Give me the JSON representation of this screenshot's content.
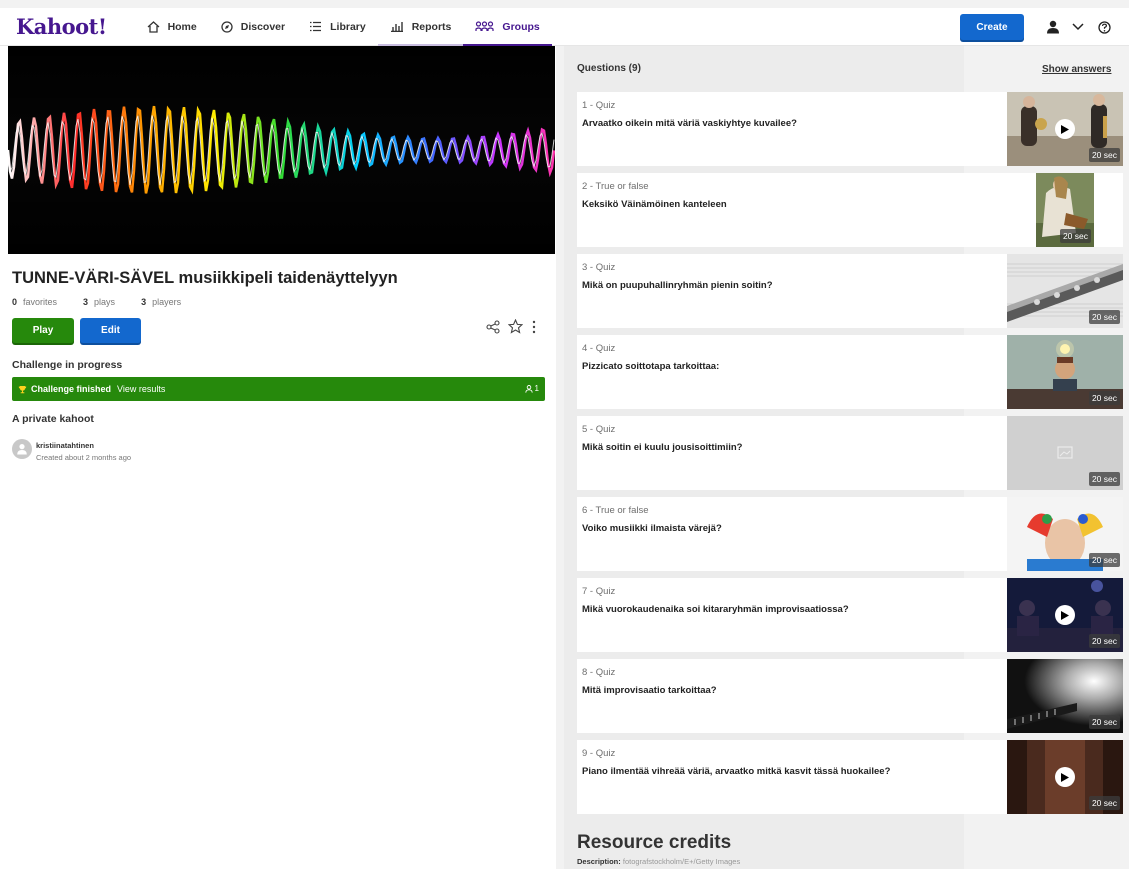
{
  "app": {
    "logo": "Kahoot!"
  },
  "nav": {
    "items": [
      {
        "label": "Home",
        "icon": "home-icon"
      },
      {
        "label": "Discover",
        "icon": "compass-icon"
      },
      {
        "label": "Library",
        "icon": "list-icon"
      },
      {
        "label": "Reports",
        "icon": "bar-chart-icon"
      },
      {
        "label": "Groups",
        "icon": "groups-icon"
      }
    ],
    "active": "Groups",
    "create_label": "Create"
  },
  "kahoot": {
    "title": "TUNNE-VÄRI-SÄVEL musiikkipeli taidenäyttelyyn",
    "stats": {
      "favorites_count": "0",
      "favorites_label": "favorites",
      "plays_count": "3",
      "plays_label": "plays",
      "players_count": "3",
      "players_label": "players"
    },
    "play_label": "Play",
    "edit_label": "Edit"
  },
  "challenge": {
    "heading": "Challenge in progress",
    "status": "Challenge finished",
    "link": "View results",
    "participant_count": "1"
  },
  "privacy": {
    "heading": "A private kahoot"
  },
  "author": {
    "name": "kristiinatahtinen",
    "created": "Created about 2 months ago"
  },
  "questions": {
    "heading": "Questions (9)",
    "show_answers": "Show answers",
    "items": [
      {
        "label": "1 - Quiz",
        "text": "Arvaatko oikein mitä väriä vaskiyhtye kuvailee?",
        "time": "20 sec",
        "video": true
      },
      {
        "label": "2 - True or false",
        "text": "Keksikö Väinämöinen kanteleen",
        "time": "20 sec",
        "video": false
      },
      {
        "label": "3 - Quiz",
        "text": "Mikä on puupuhallinryhmän pienin soitin?",
        "time": "20 sec",
        "video": false
      },
      {
        "label": "4 - Quiz",
        "text": "Pizzicato soittotapa tarkoittaa:",
        "time": "20 sec",
        "video": false
      },
      {
        "label": "5 - Quiz",
        "text": "Mikä soitin ei kuulu jousisoittimiin?",
        "time": "20 sec",
        "video": false
      },
      {
        "label": "6 - True or false",
        "text": "Voiko musiikki ilmaista värejä?",
        "time": "20 sec",
        "video": false
      },
      {
        "label": "7 - Quiz",
        "text": "Mikä vuorokaudenaika soi kitararyhmän improvisaatiossa?",
        "time": "20 sec",
        "video": true
      },
      {
        "label": "8 - Quiz",
        "text": "Mitä improvisaatio tarkoittaa?",
        "time": "20 sec",
        "video": false
      },
      {
        "label": "9 - Quiz",
        "text": "Piano ilmentää vihreää väriä, arvaatko mitkä kasvit tässä huokailee?",
        "time": "20 sec",
        "video": true
      }
    ]
  },
  "credits": {
    "title": "Resource credits",
    "desc_label": "Description:",
    "desc_value": "fotografstockholm/E+/Getty Images"
  },
  "colors": {
    "brand": "#46178f",
    "blue": "#1368ce",
    "green": "#26890c"
  }
}
